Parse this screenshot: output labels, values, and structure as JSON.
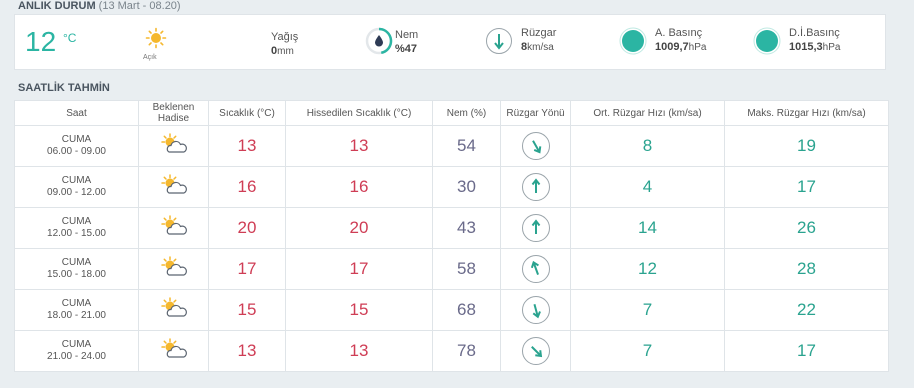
{
  "current": {
    "section_title": "ANLIK DURUM",
    "section_date": "(13 Mart - 08.20)",
    "temperature": "12",
    "temperature_unit": "°C",
    "condition": "Açık",
    "condition_icon": "sun-icon",
    "rain_label": "Yağış",
    "rain_value": "0",
    "rain_unit": "mm",
    "humidity_label": "Nem",
    "humidity_value": "%47",
    "humidity_icon": "drop-icon",
    "humidity_fraction": 0.47,
    "wind_label": "Rüzgar",
    "wind_value": "8",
    "wind_unit": "km/sa",
    "pressure_label": "A. Basınç",
    "pressure_value": "1009,7",
    "pressure_unit": "hPa",
    "sea_pressure_label": "D.İ.Basınç",
    "sea_pressure_value": "1015,3",
    "sea_pressure_unit": "hPa",
    "accent_color": "#2bb5a3"
  },
  "hourly": {
    "section_title": "SAATLİK TAHMİN",
    "headers": {
      "time": "Saat",
      "event_line1": "Beklenen",
      "event_line2": "Hadise",
      "temp": "Sıcaklık (°C)",
      "feels": "Hissedilen Sıcaklık (°C)",
      "humidity": "Nem (%)",
      "wind_dir": "Rüzgar Yönü",
      "wind_avg": "Ort. Rüzgar Hızı (km/sa)",
      "wind_max": "Maks. Rüzgar Hızı (km/sa)"
    },
    "rows": [
      {
        "day": "CUMA",
        "range": "06.00 - 09.00",
        "icon": "partly-cloudy-icon",
        "temp": "13",
        "feels": "13",
        "humidity": "54",
        "wind_dir_deg": 150,
        "wind_avg": "8",
        "wind_max": "19"
      },
      {
        "day": "CUMA",
        "range": "09.00 - 12.00",
        "icon": "partly-cloudy-icon",
        "temp": "16",
        "feels": "16",
        "humidity": "30",
        "wind_dir_deg": 0,
        "wind_avg": "4",
        "wind_max": "17"
      },
      {
        "day": "CUMA",
        "range": "12.00 - 15.00",
        "icon": "partly-cloudy-icon",
        "temp": "20",
        "feels": "20",
        "humidity": "43",
        "wind_dir_deg": 0,
        "wind_avg": "14",
        "wind_max": "26"
      },
      {
        "day": "CUMA",
        "range": "15.00 - 18.00",
        "icon": "partly-cloudy-icon",
        "temp": "17",
        "feels": "17",
        "humidity": "58",
        "wind_dir_deg": -20,
        "wind_avg": "12",
        "wind_max": "28"
      },
      {
        "day": "CUMA",
        "range": "18.00 - 21.00",
        "icon": "partly-cloudy-icon",
        "temp": "15",
        "feels": "15",
        "humidity": "68",
        "wind_dir_deg": 165,
        "wind_avg": "7",
        "wind_max": "22"
      },
      {
        "day": "CUMA",
        "range": "21.00 - 24.00",
        "icon": "partly-cloudy-icon",
        "temp": "13",
        "feels": "13",
        "humidity": "78",
        "wind_dir_deg": 135,
        "wind_avg": "7",
        "wind_max": "17"
      }
    ]
  },
  "colors": {
    "temp": "#cf3d55",
    "humidity": "#6a6a8a",
    "wind": "#2aa38f"
  }
}
